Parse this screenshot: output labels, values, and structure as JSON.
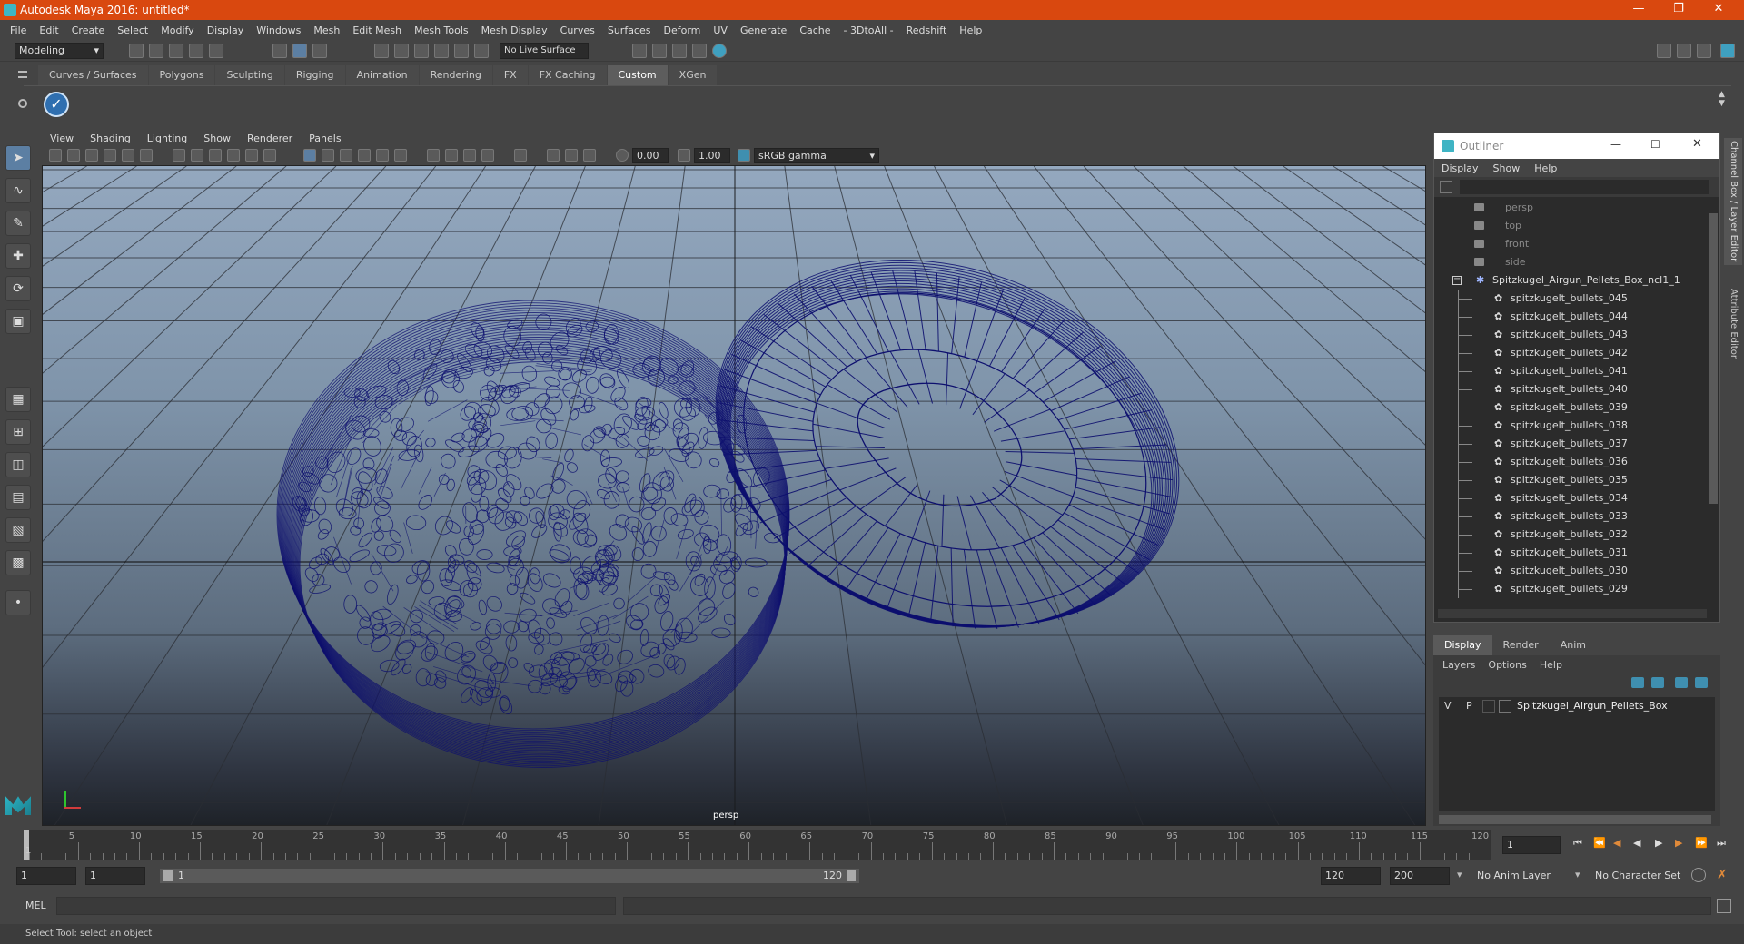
{
  "app": {
    "title": "Autodesk Maya 2016: untitled*"
  },
  "menubar": [
    "File",
    "Edit",
    "Create",
    "Select",
    "Modify",
    "Display",
    "Windows",
    "Mesh",
    "Edit Mesh",
    "Mesh Tools",
    "Mesh Display",
    "Curves",
    "Surfaces",
    "Deform",
    "UV",
    "Generate",
    "Cache",
    "- 3DtoAll -",
    "Redshift",
    "Help"
  ],
  "statusline": {
    "mode": "Modeling",
    "live_surface": "No Live Surface"
  },
  "shelf_tabs": [
    "Curves / Surfaces",
    "Polygons",
    "Sculpting",
    "Rigging",
    "Animation",
    "Rendering",
    "FX",
    "FX Caching",
    "Custom",
    "XGen"
  ],
  "shelf_active": "Custom",
  "viewport": {
    "menu": [
      "View",
      "Shading",
      "Lighting",
      "Show",
      "Renderer",
      "Panels"
    ],
    "exposure": "0.00",
    "gamma": "1.00",
    "color_space": "sRGB gamma",
    "camera_label": "persp",
    "wire_color": "#0d0f6e"
  },
  "outliner": {
    "title": "Outliner",
    "menu": [
      "Display",
      "Show",
      "Help"
    ],
    "cameras": [
      "persp",
      "top",
      "front",
      "side"
    ],
    "group": "Spitzkugel_Airgun_Pellets_Box_ncl1_1",
    "items": [
      "spitzkugelt_bullets_045",
      "spitzkugelt_bullets_044",
      "spitzkugelt_bullets_043",
      "spitzkugelt_bullets_042",
      "spitzkugelt_bullets_041",
      "spitzkugelt_bullets_040",
      "spitzkugelt_bullets_039",
      "spitzkugelt_bullets_038",
      "spitzkugelt_bullets_037",
      "spitzkugelt_bullets_036",
      "spitzkugelt_bullets_035",
      "spitzkugelt_bullets_034",
      "spitzkugelt_bullets_033",
      "spitzkugelt_bullets_032",
      "spitzkugelt_bullets_031",
      "spitzkugelt_bullets_030",
      "spitzkugelt_bullets_029"
    ]
  },
  "layer_editor": {
    "tabs": [
      "Display",
      "Render",
      "Anim"
    ],
    "menu": [
      "Layers",
      "Options",
      "Help"
    ],
    "layer": {
      "v": "V",
      "p": "P",
      "name": "Spitzkugel_Airgun_Pellets_Box"
    }
  },
  "side_tabs": [
    "Channel Box / Layer Editor",
    "Attribute Editor"
  ],
  "timeline": {
    "ticks": [
      "5",
      "10",
      "15",
      "20",
      "25",
      "30",
      "35",
      "40",
      "45",
      "50",
      "55",
      "60",
      "65",
      "70",
      "75",
      "80",
      "85",
      "90",
      "95",
      "100",
      "105",
      "110",
      "115",
      "120"
    ],
    "start_tick": "1",
    "current_frame": "1"
  },
  "range": {
    "start": "1",
    "anim_start": "1",
    "slider_start": "1",
    "slider_end": "120",
    "end": "120",
    "anim_end": "200",
    "anim_layer": "No Anim Layer",
    "character_set": "No Character Set"
  },
  "mel": {
    "label": "MEL"
  },
  "help_line": "Select Tool: select an object"
}
